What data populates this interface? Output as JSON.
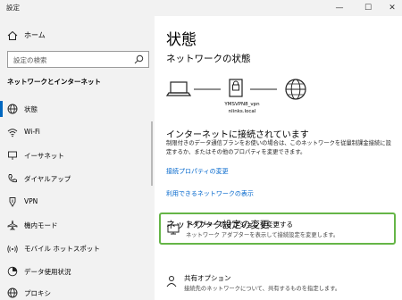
{
  "window": {
    "title": "設定",
    "minimize": "—",
    "maximize": "☐",
    "close": "✕"
  },
  "sidebar": {
    "home_label": "ホーム",
    "search_placeholder": "設定の検索",
    "section_title": "ネットワークとインターネット",
    "items": [
      {
        "label": "状態",
        "icon": "globe-icon",
        "active": true
      },
      {
        "label": "Wi-Fi",
        "icon": "wifi-icon"
      },
      {
        "label": "イーサネット",
        "icon": "ethernet-icon"
      },
      {
        "label": "ダイヤルアップ",
        "icon": "phone-icon"
      },
      {
        "label": "VPN",
        "icon": "vpn-icon"
      },
      {
        "label": "機内モード",
        "icon": "airplane-icon"
      },
      {
        "label": "モバイル ホットスポット",
        "icon": "hotspot-icon"
      },
      {
        "label": "データ使用状況",
        "icon": "data-usage-icon"
      },
      {
        "label": "プロキシ",
        "icon": "globe-icon"
      }
    ]
  },
  "main": {
    "title": "状態",
    "network_status_heading": "ネットワークの状態",
    "vpn_name_line1": "YMSVPN8_vpn",
    "vpn_name_line2": "nlinks.local",
    "connection_title": "インターネットに接続されています",
    "connection_desc": "制限付きのデータ通信プランをお使いの場合は、このネットワークを従量制課金接続に設定するか、またはその他のプロパティを変更できます。",
    "link_properties": "接続プロパティの変更",
    "link_networks": "利用できるネットワークの表示",
    "change_heading": "ネットワーク設定の変更",
    "cards": [
      {
        "title": "アダプターのオプションを変更する",
        "subtitle": "ネットワーク アダプターを表示して接続設定を変更します。",
        "icon": "adapter-icon"
      },
      {
        "title": "共有オプション",
        "subtitle": "接続先のネットワークについて、共有するものを指定します。",
        "icon": "share-icon"
      }
    ]
  }
}
